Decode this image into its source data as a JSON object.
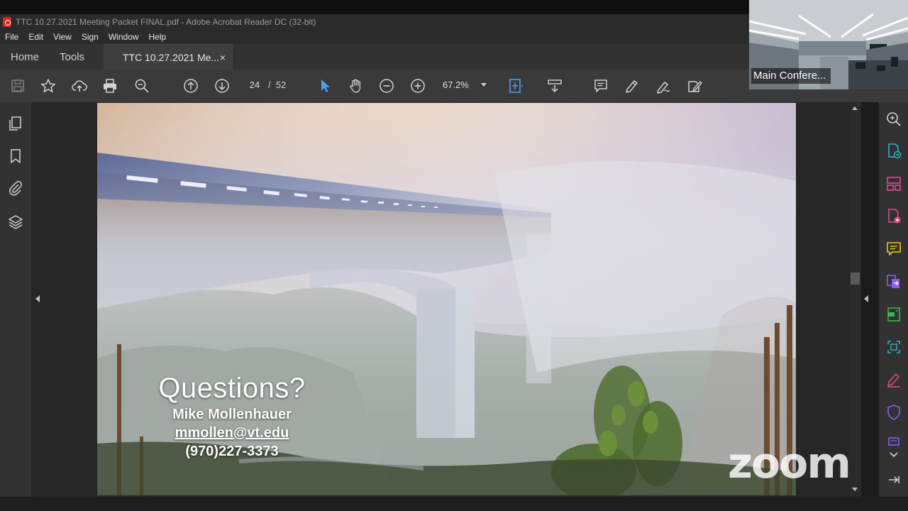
{
  "window": {
    "title": "TTC 10.27.2021 Meeting Packet FINAL.pdf - Adobe Acrobat Reader DC (32-bit)"
  },
  "menu": [
    "File",
    "Edit",
    "View",
    "Sign",
    "Window",
    "Help"
  ],
  "tabs": {
    "home": "Home",
    "tools": "Tools",
    "document": "TTC 10.27.2021 Me...",
    "close": "×"
  },
  "toolbar": {
    "current_page": "24",
    "page_separator": "/",
    "total_pages": "52",
    "zoom": "67.2%"
  },
  "slide": {
    "heading": "Questions?",
    "name": "Mike Mollenhauer",
    "email": "mmollen@vt.edu",
    "phone": "(970)227-3373"
  },
  "video": {
    "label": "Main Confere..."
  },
  "watermark": "zoom",
  "colors": {
    "accent_blue": "#4a9eea",
    "tools_pink": "#e04a8a",
    "tools_teal": "#2ab3c4",
    "tools_yellow": "#f2c21a",
    "tools_green": "#3ab54a",
    "tools_purple": "#8b5cf6",
    "pdf_red": "#d7261e"
  }
}
